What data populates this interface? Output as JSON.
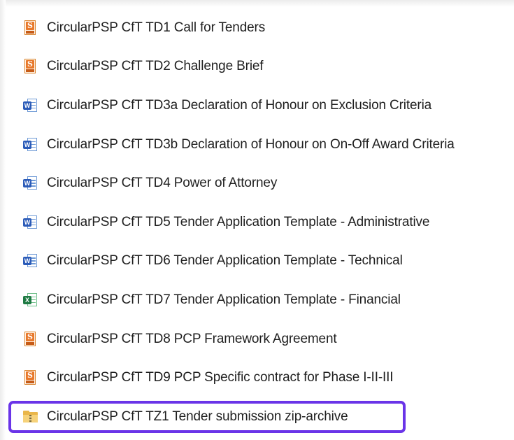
{
  "files": [
    {
      "name": "CircularPSP CfT TD1 Call for Tenders",
      "type": "pdf",
      "icon": "pdf-file-icon"
    },
    {
      "name": "CircularPSP CfT TD2 Challenge Brief",
      "type": "pdf",
      "icon": "pdf-file-icon"
    },
    {
      "name": "CircularPSP CfT TD3a Declaration of Honour on Exclusion Criteria",
      "type": "docx",
      "icon": "word-document-icon"
    },
    {
      "name": "CircularPSP CfT TD3b Declaration of Honour on On-Off Award Criteria",
      "type": "docx",
      "icon": "word-document-icon"
    },
    {
      "name": "CircularPSP CfT TD4 Power of Attorney",
      "type": "docx",
      "icon": "word-document-icon"
    },
    {
      "name": "CircularPSP CfT TD5 Tender Application Template - Administrative",
      "type": "docx",
      "icon": "word-document-icon"
    },
    {
      "name": "CircularPSP CfT TD6 Tender Application Template - Technical",
      "type": "docx",
      "icon": "word-document-icon"
    },
    {
      "name": "CircularPSP CfT TD7 Tender Application Template - Financial",
      "type": "xlsx",
      "icon": "excel-spreadsheet-icon"
    },
    {
      "name": "CircularPSP CfT TD8 PCP Framework Agreement",
      "type": "pdf",
      "icon": "pdf-file-icon"
    },
    {
      "name": "CircularPSP CfT TD9 PCP Specific contract for Phase I-II-III",
      "type": "pdf",
      "icon": "pdf-file-icon"
    },
    {
      "name": "CircularPSP CfT TZ1 Tender submission zip-archive",
      "type": "zip",
      "icon": "zip-folder-icon",
      "highlighted": true
    }
  ],
  "colors": {
    "highlight": "#6a34e8",
    "text": "#1f1f1f"
  }
}
